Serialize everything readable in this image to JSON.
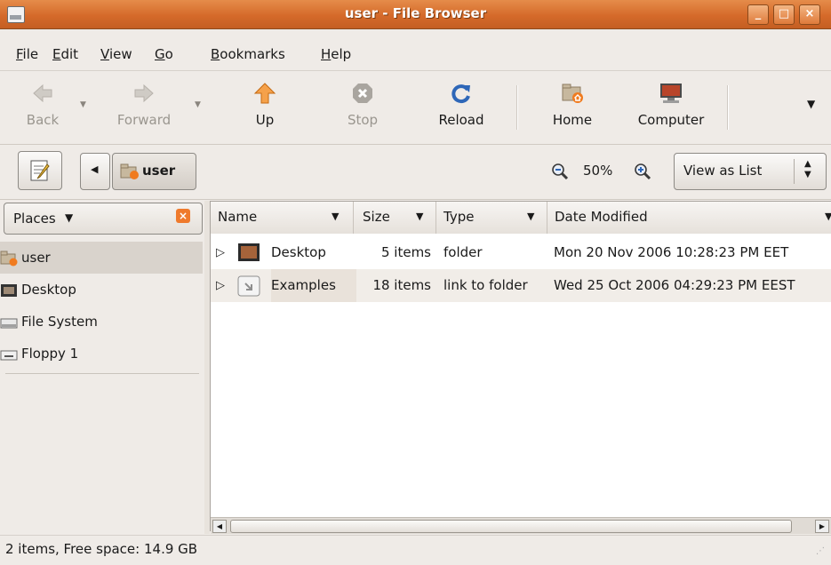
{
  "window": {
    "title": "user - File Browser"
  },
  "menu": {
    "file": {
      "u": "F",
      "rest": "ile"
    },
    "edit": {
      "u": "E",
      "rest": "dit"
    },
    "view": {
      "u": "V",
      "rest": "iew"
    },
    "go": {
      "u": "G",
      "rest": "o"
    },
    "bookmarks": {
      "u": "B",
      "rest": "ookmarks"
    },
    "help": {
      "u": "H",
      "rest": "elp"
    }
  },
  "toolbar": {
    "back": "Back",
    "forward": "Forward",
    "up": "Up",
    "stop": "Stop",
    "reload": "Reload",
    "home": "Home",
    "computer": "Computer"
  },
  "location": {
    "path_label": "user",
    "zoom": "50%",
    "view_mode": "View as List"
  },
  "sidebar": {
    "header": "Places",
    "items": [
      {
        "label": "user"
      },
      {
        "label": "Desktop"
      },
      {
        "label": "File System"
      },
      {
        "label": "Floppy 1"
      }
    ]
  },
  "list": {
    "columns": {
      "name": "Name",
      "size": "Size",
      "type": "Type",
      "date": "Date Modified"
    },
    "rows": [
      {
        "name": "Desktop",
        "size": "5 items",
        "type": "folder",
        "date": "Mon 20 Nov 2006 10:28:23 PM EET"
      },
      {
        "name": "Examples",
        "size": "18 items",
        "type": "link to folder",
        "date": "Wed 25 Oct 2006 04:29:23 PM EEST"
      }
    ]
  },
  "status": {
    "text": "2 items, Free space: 14.9 GB"
  },
  "colors": {
    "titlebar": "#d56a2a",
    "selection": "#d9d3cc"
  }
}
